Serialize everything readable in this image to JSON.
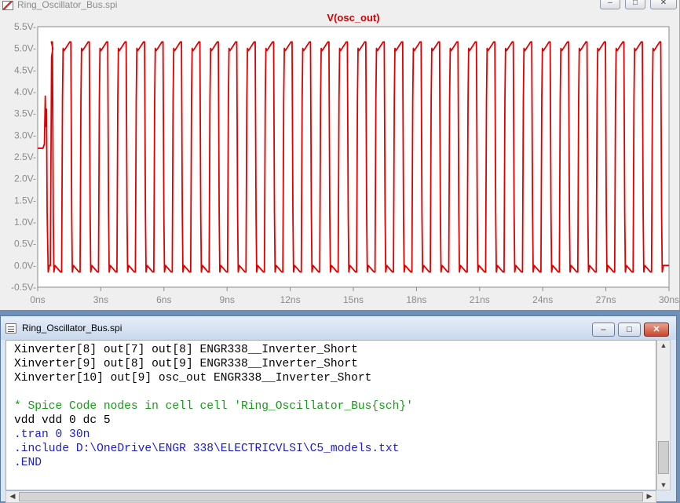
{
  "plot_window": {
    "title": "Ring_Oscillator_Bus.spi",
    "buttons": {
      "minimize": "–",
      "maximize": "□",
      "close": "✕"
    }
  },
  "chart_data": {
    "type": "line",
    "title": "V(osc_out)",
    "xlabel": "",
    "ylabel": "",
    "xlim": [
      0,
      30
    ],
    "ylim": [
      -0.5,
      5.5
    ],
    "x_ticks": [
      "0ns",
      "3ns",
      "6ns",
      "9ns",
      "12ns",
      "15ns",
      "18ns",
      "21ns",
      "24ns",
      "27ns",
      "30ns"
    ],
    "y_ticks": [
      "5.5V-",
      "5.0V-",
      "4.5V-",
      "4.0V-",
      "3.5V-",
      "3.0V-",
      "2.5V-",
      "2.0V-",
      "1.5V-",
      "1.0V-",
      "0.5V-",
      "0.0V-",
      "-0.5V-"
    ],
    "grid": false,
    "series": [
      {
        "name": "V(osc_out)",
        "color": "#e00000",
        "initial_level": 2.7,
        "startup_peak": 3.9,
        "high_level": 5.0,
        "high_overshoot": 5.15,
        "low_level": 0.0,
        "low_undershoot": -0.15,
        "period_ns": 0.876,
        "first_fall_ns": 0.7,
        "t_end_ns": 30
      }
    ]
  },
  "netlist_window": {
    "title": "Ring_Oscillator_Bus.spi",
    "buttons": {
      "minimize": "–",
      "maximize": "□",
      "close": "✕"
    },
    "lines": [
      {
        "text": "Xinverter[8] out[7] out[8] ENGR338__Inverter_Short",
        "color": "#000000"
      },
      {
        "text": "Xinverter[9] out[8] out[9] ENGR338__Inverter_Short",
        "color": "#000000"
      },
      {
        "text": "Xinverter[10] out[9] osc_out ENGR338__Inverter_Short",
        "color": "#000000"
      },
      {
        "text": "",
        "color": "#000000"
      },
      {
        "text": "* Spice Code nodes in cell cell 'Ring_Oscillator_Bus{sch}'",
        "color": "#1a9a1a"
      },
      {
        "text": "vdd vdd 0 dc 5",
        "color": "#000000"
      },
      {
        "text": ".tran 0 30n",
        "color": "#1c1ccc"
      },
      {
        "text": ".include D:\\OneDrive\\ENGR 338\\ELECTRICVLSI\\C5_models.txt",
        "color": "#1c1ccc"
      },
      {
        "text": ".END",
        "color": "#1c1ccc"
      }
    ]
  }
}
